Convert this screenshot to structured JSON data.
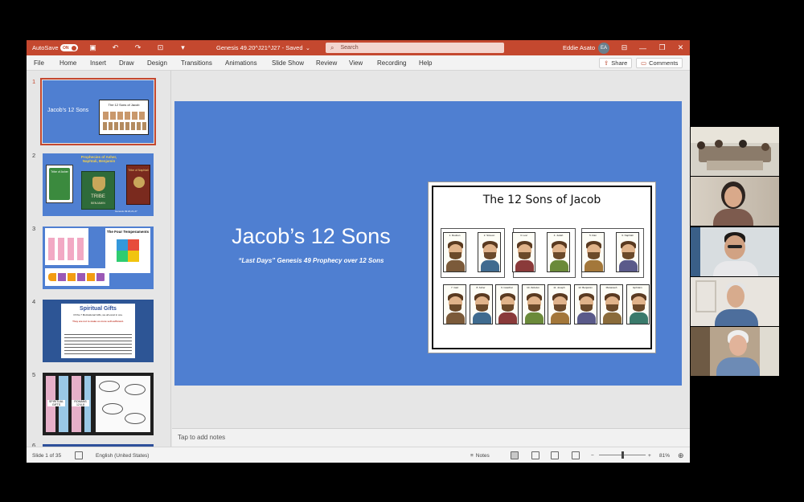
{
  "titlebar": {
    "autosave_label": "AutoSave",
    "autosave_state": "ON",
    "doc_title": "Genesis 49.20^J21^J27  -  Saved",
    "search_placeholder": "Search",
    "user_name": "Eddie Asato",
    "user_initials": "EA"
  },
  "menu": {
    "items": [
      "File",
      "Home",
      "Insert",
      "Draw",
      "Design",
      "Transitions",
      "Animations",
      "Slide Show",
      "Review",
      "View",
      "Recording",
      "Help"
    ],
    "share_label": "Share",
    "comments_label": "Comments"
  },
  "thumbnails": [
    {
      "number": "1",
      "title": "Jacob's 12 Sons",
      "card_title": "The 12 Sons of Jacob"
    },
    {
      "number": "2",
      "title": "Prophecies of Asher, Naphtali, Benjamin",
      "tribe_left": "Tribe of Asher",
      "tribe_center": "TRIBE",
      "tribe_center_sub": "BENJAMIN",
      "tribe_right": "Tribe of Naphtali",
      "ref": "Genesis 49:20,21,27"
    },
    {
      "number": "3",
      "title": "The Four Temperaments"
    },
    {
      "number": "4",
      "title": "Spiritual Gifts",
      "line1": "Of the 7 Motivational Gifts, we all excel in one.",
      "line2": "They are not to make us more self-sufficient."
    },
    {
      "number": "5",
      "label_a": "SPIRITUAL GIFTS",
      "label_b": "ROMANS 12:6-8"
    },
    {
      "number": "6"
    }
  ],
  "slide": {
    "title": "Jacob’s 12 Sons",
    "subtitle": "“Last Days” Genesis 49 Prophecy over 12 Sons",
    "card_title": "The 12 Sons of Jacob",
    "sons_top": [
      "1. Reuben",
      "2. Simeon",
      "3. Levi",
      "4. Judah",
      "5. Dan",
      "6. Naphtali"
    ],
    "sons_bottom": [
      "7. Gad",
      "8. Asher",
      "9. Issachar",
      "10. Zebulun",
      "11. Joseph",
      "12. Benjamin",
      "Manasseh",
      "Ephraim"
    ]
  },
  "notes_placeholder": "Tap to add notes",
  "status": {
    "slide_counter": "Slide 1 of 35",
    "language": "English (United States)",
    "notes_label": "Notes",
    "zoom": "81%",
    "zoom_fraction": 0.5
  },
  "participants_count": 5,
  "colors": {
    "accent": "#c4482f",
    "slide_bg": "#4f7fd1"
  }
}
